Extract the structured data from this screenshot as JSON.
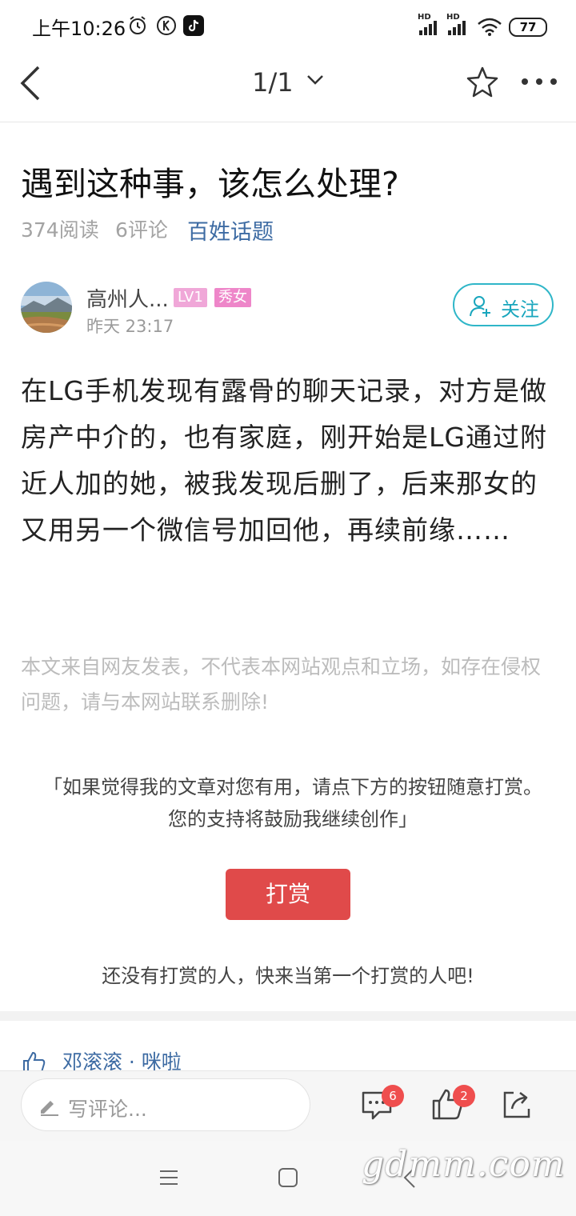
{
  "status_bar": {
    "time": "上午10:26",
    "battery": "77",
    "signal_label_1": "HD",
    "signal_label_2": "HD"
  },
  "nav": {
    "page_indicator": "1/1",
    "icons": [
      "back-arrow-icon",
      "chevron-down-icon",
      "star-icon",
      "more-icon"
    ]
  },
  "article": {
    "title": "遇到这种事，该怎么处理?",
    "reads": "374阅读",
    "comments": "6评论",
    "topic": "百姓话题",
    "author": {
      "name": "高州人...",
      "level_badge": "LV1",
      "tag_badge": "秀女",
      "time": "昨天 23:17",
      "follow_label": "关注"
    },
    "content": "在LG手机发现有露骨的聊天记录，对方是做房产中介的，也有家庭，刚开始是LG通过附近人加的她，被我发现后删了，后来那女的又用另一个微信号加回他，再续前缘……",
    "disclaimer": "本文来自网友发表，不代表本网站观点和立场，如存在侵权问题，请与本网站联系删除!"
  },
  "reward": {
    "quote": "「如果觉得我的文章对您有用，请点下方的按钮随意打赏。您的支持将鼓励我继续创作」",
    "button_label": "打赏",
    "empty_text": "还没有打赏的人，快来当第一个打赏的人吧!"
  },
  "likes": {
    "names": "邓滚滚 · 咪啦"
  },
  "comment_bar": {
    "placeholder": "写评论...",
    "comment_count": "6",
    "like_count": "2"
  },
  "watermark": "gdmm.com",
  "colors": {
    "accent": "#19a6bd",
    "reward": "#e04a4a",
    "topic": "#3d6ba3",
    "badge_level": "#f0a7d8",
    "badge_tag": "#ee86c9"
  }
}
